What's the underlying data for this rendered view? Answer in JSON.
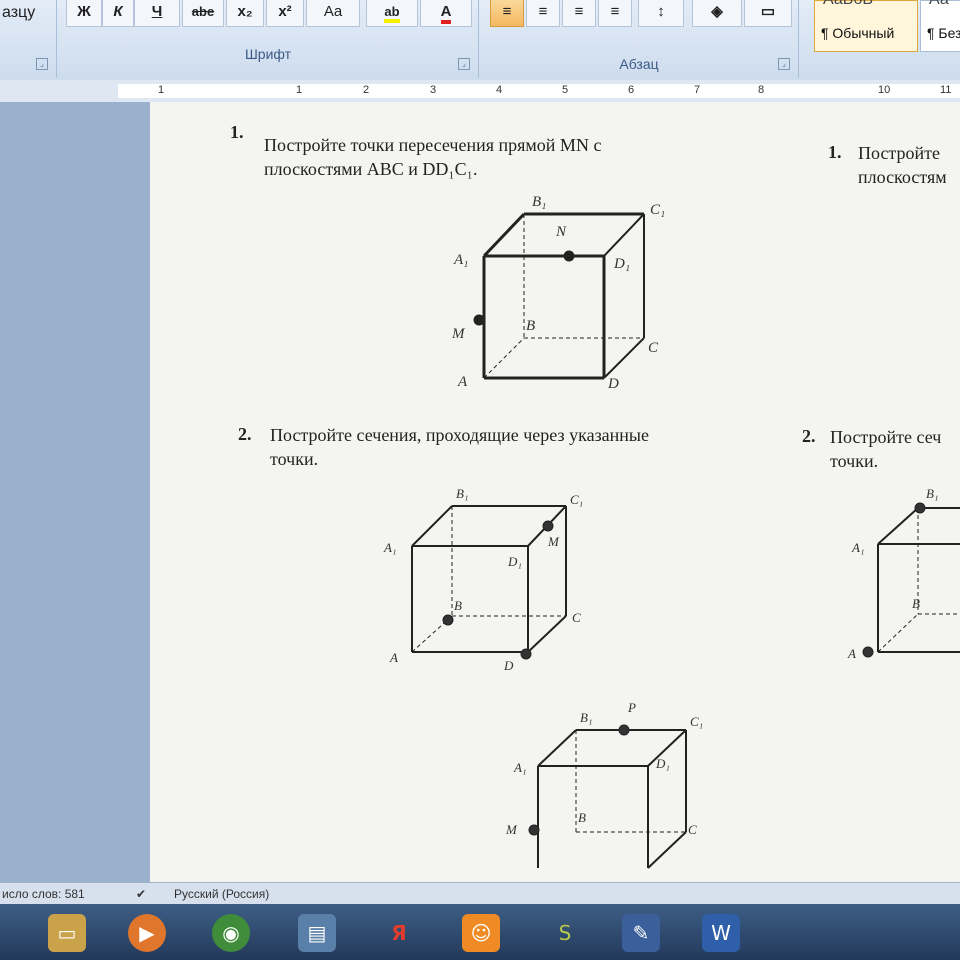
{
  "ribbon": {
    "clipboard_fragment": "азцу",
    "font_group_label": "Шрифт",
    "paragraph_group_label": "Абзац",
    "font_buttons": [
      "Ж",
      "К",
      "Ч",
      "abe",
      "x₂",
      "x²",
      "Aa"
    ],
    "highlight_label": "ab",
    "font_color_label": "A",
    "style_normal": "¶ Обычный",
    "style_no_spacing": "¶ Без",
    "style_preview_1": "АаБбВ",
    "style_preview_2": "Аа"
  },
  "ruler": {
    "marks": [
      "1",
      "1",
      "2",
      "3",
      "4",
      "5",
      "6",
      "7",
      "8",
      "10",
      "11"
    ]
  },
  "document": {
    "task1": {
      "number": "1.",
      "line1": "Постройте точки пересечения прямой MN с",
      "line2": "плоскостями ABC и DD₁C₁."
    },
    "task1_right": {
      "number": "1.",
      "line1": "Постройте",
      "line2": "плоскостям"
    },
    "task2": {
      "number": "2.",
      "line1": "Постройте сечения, проходящие через указанные",
      "line2": "точки."
    },
    "task2_right": {
      "number": "2.",
      "line1": "Постройте сеч",
      "line2": "точки."
    },
    "cube1_labels": {
      "B1": "B₁",
      "C1": "C₁",
      "A1": "A₁",
      "D1": "D₁",
      "N": "N",
      "M": "M",
      "B": "B",
      "C": "C",
      "A": "A",
      "D": "D"
    },
    "cube2_labels": {
      "B1": "B₁",
      "C1": "C₁",
      "A1": "A₁",
      "D1": "D₁",
      "M": "M",
      "B": "B",
      "C": "C",
      "A": "A",
      "D": "D"
    },
    "cube3_labels": {
      "B1": "B₁",
      "P": "P",
      "C1": "C₁",
      "A1": "A₁",
      "D1": "D₁",
      "M": "M",
      "B": "B",
      "C": "C"
    },
    "cube4_labels": {
      "B1": "B₁",
      "A1": "A₁",
      "B": "B",
      "A": "A"
    }
  },
  "status": {
    "word_count": "исло слов: 581",
    "language": "Русский (Россия)"
  },
  "taskbar": {
    "yandex": "Я"
  },
  "colors": {
    "ribbon_top": "#e3ecf7",
    "page_bg": "#f4f4f1",
    "workspace": "#9ab0cc",
    "taskbar": "#2f4a6e"
  }
}
